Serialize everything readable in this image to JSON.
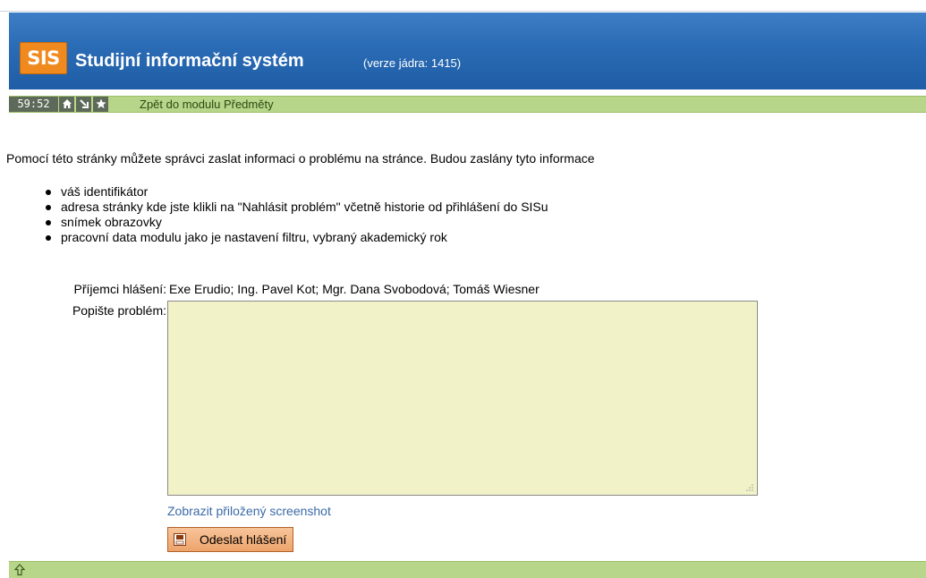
{
  "header": {
    "logo_text": "SIS",
    "title": "Studijní informační systém",
    "version": "(verze jádra: 1415)"
  },
  "toolbar": {
    "timer": "59:52",
    "icons": [
      "home-icon",
      "arrow-down-right-icon",
      "star-icon"
    ],
    "back_link": "Zpět do modulu Předměty"
  },
  "main": {
    "intro": "Pomocí této stránky můžete správci zaslat informaci o problému na stránce. Budou zaslány tyto informace",
    "items": [
      "váš identifikátor",
      "adresa stránky kde jste klikli na \"Nahlásit problém\" včetně historie od přihlášení do SISu",
      "snímek obrazovky",
      "pracovní data modulu jako je nastavení filtru, vybraný akademický rok"
    ],
    "recipients_label": "Příjemci hlášení:",
    "recipients_value": "Exe Erudio; Ing. Pavel Kot; Mgr. Dana Svobodová; Tomáš Wiesner",
    "describe_label": "Popište problém:",
    "problem_value": "",
    "screenshot_link": "Zobrazit přiložený screenshot",
    "send_button": "Odeslat hlášení"
  },
  "footer": {
    "icon": "arrow-up-icon"
  },
  "colors": {
    "header_blue": "#2a6bb5",
    "logo_orange": "#f08a1e",
    "toolbar_green": "#b8d68a",
    "textarea_bg": "#f2f2c8",
    "button_orange": "#eea46c",
    "link_blue": "#3a6aa8"
  }
}
